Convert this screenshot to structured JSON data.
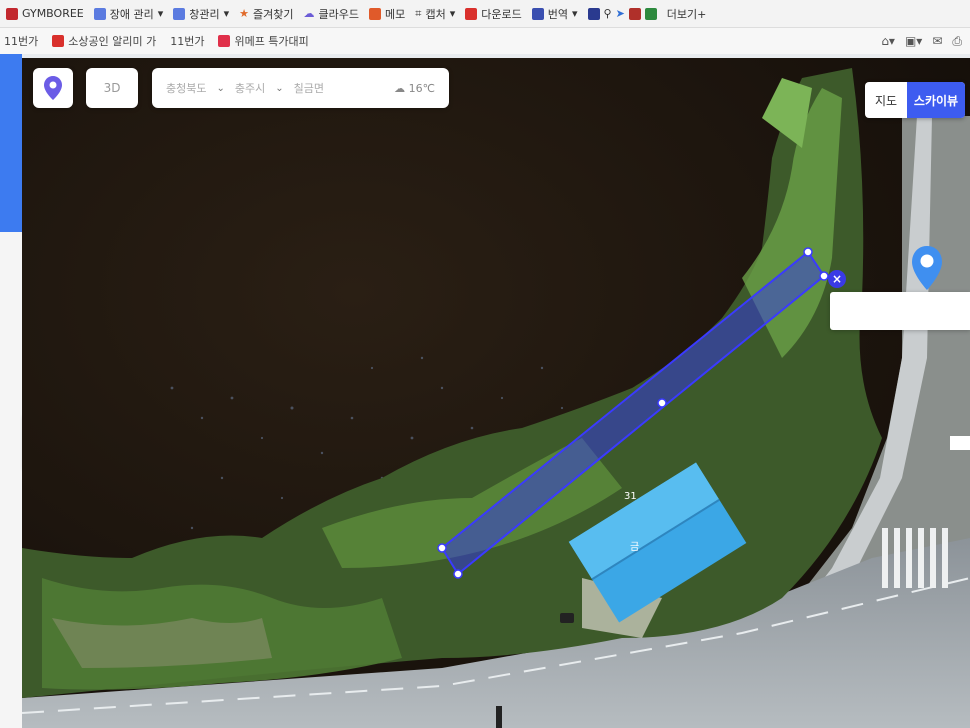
{
  "bookmarks": {
    "row1": [
      {
        "label": "GYMBOREE",
        "icon": "site-icon",
        "color": "#c2282e"
      },
      {
        "label": "장애 관리",
        "icon": "folder-icon",
        "color": "#5b7be0"
      },
      {
        "label": "창관리",
        "icon": "folder-icon",
        "color": "#5b7be0"
      },
      {
        "label": "즐겨찾기",
        "icon": "star-icon",
        "color": "#e06a2a"
      },
      {
        "label": "클라우드",
        "icon": "cloud-icon",
        "color": "#6b5cd6"
      },
      {
        "label": "메모",
        "icon": "memo-icon",
        "color": "#e05a2a"
      },
      {
        "label": "캡처",
        "icon": "crop-icon",
        "color": "#333333"
      },
      {
        "label": "다운로드",
        "icon": "download-icon",
        "color": "#d9302c"
      },
      {
        "label": "번역",
        "icon": "translate-icon",
        "color": "#3a4fb0"
      },
      {
        "label": "더보기+",
        "icon": "shield-icon",
        "color": "#2d8a3e"
      }
    ],
    "row2": [
      {
        "label": "11번가",
        "icon": "site-icon"
      },
      {
        "label": "소상공인 알리미 가",
        "icon": "site-icon"
      },
      {
        "label": "11번가",
        "icon": "site-icon"
      },
      {
        "label": "위메프 특가대피",
        "icon": "site-icon"
      }
    ]
  },
  "map": {
    "controls": {
      "view_button": "3D"
    },
    "address": {
      "province": "충청북도",
      "city": "충주시",
      "district": "칠금면",
      "weather": "16℃"
    },
    "map_type": {
      "map_label": "지도",
      "skyview_label": "스카이뷰",
      "active": "skyview"
    },
    "building_label_1": "31",
    "building_label_2": "금",
    "colors": {
      "measure_line": "#3030ff",
      "skyview_active": "#3d5cf0",
      "marker": "#3f8ff0"
    }
  }
}
